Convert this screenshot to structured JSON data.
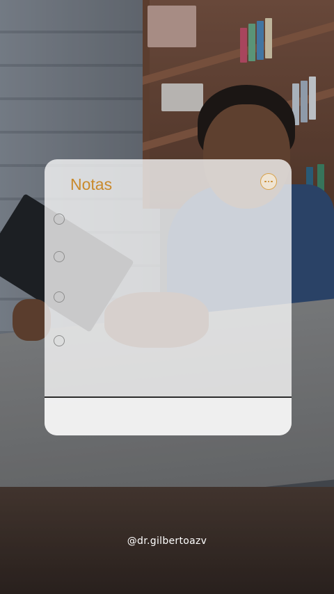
{
  "notes": {
    "title": "Notas",
    "items": [
      {
        "text": ""
      },
      {
        "text": ""
      },
      {
        "text": ""
      },
      {
        "text": ""
      }
    ]
  },
  "icons": {
    "more": "more-options-icon",
    "checkbox": "checkbox-circle-icon"
  },
  "footer": {
    "handle": "@dr.gilbertoazv"
  },
  "colors": {
    "accent": "#c98a2c",
    "card_bg": "#fafafa",
    "handle_text": "#ffffff"
  }
}
